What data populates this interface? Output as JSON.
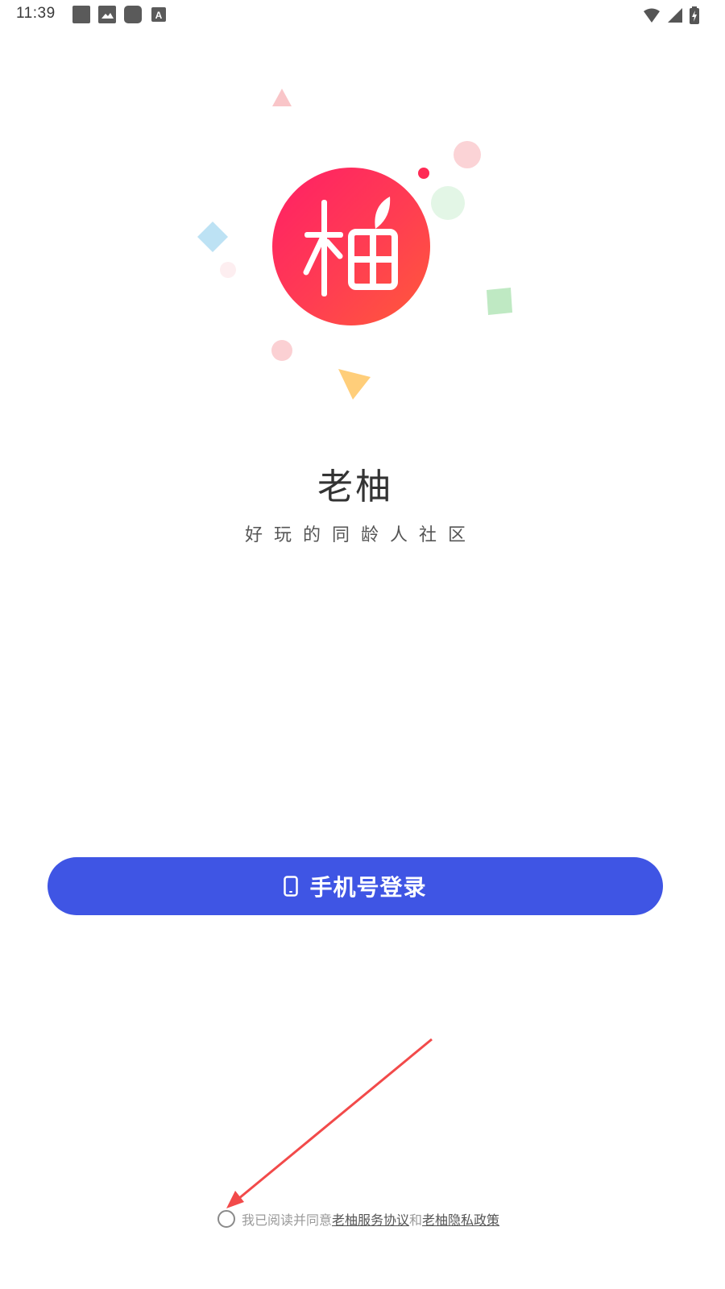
{
  "status_bar": {
    "time": "11:39",
    "notification_icons": [
      "square-app-icon",
      "image-icon",
      "rounded-square-app-icon",
      "font-a-icon"
    ],
    "right_icons": [
      "wifi-icon",
      "signal-icon",
      "battery-charging-icon"
    ]
  },
  "app": {
    "logo_char": "柚",
    "name": "老柚",
    "slogan": "好玩的同龄人社区"
  },
  "login": {
    "button_label": "手机号登录",
    "button_icon": "phone-icon"
  },
  "agreement": {
    "prefix": "我已阅读并同意",
    "terms_link": "老柚服务协议",
    "joiner": "和",
    "privacy_link": "老柚隐私政策",
    "checked": false
  },
  "colors": {
    "primary": "#3f55e4",
    "logo_gradient_start": "#ff1f66",
    "logo_gradient_end": "#ff5a3a",
    "annotation_arrow": "#f24a4a"
  }
}
